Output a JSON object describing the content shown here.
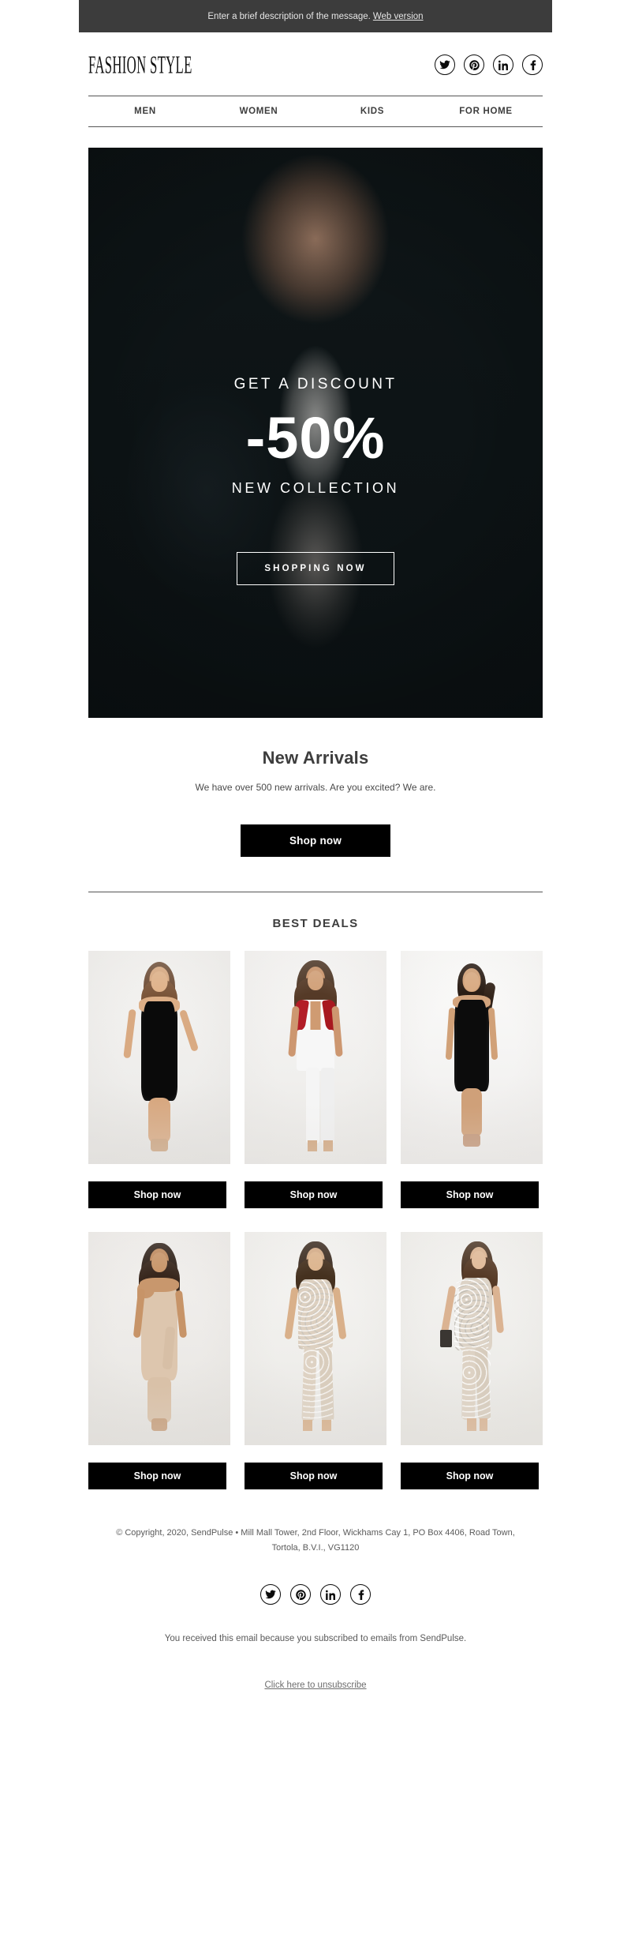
{
  "preheader": {
    "text": "Enter a brief description of the message.",
    "link_label": "Web version",
    "bg_color": "#3c3c3c"
  },
  "header": {
    "logo": "FASHION STYLE",
    "social": [
      {
        "name": "twitter",
        "label": "Twitter"
      },
      {
        "name": "pinterest",
        "label": "Pinterest"
      },
      {
        "name": "linkedin",
        "label": "LinkedIn"
      },
      {
        "name": "facebook",
        "label": "Facebook"
      }
    ]
  },
  "nav": {
    "items": [
      {
        "label": "MEN"
      },
      {
        "label": "WOMEN"
      },
      {
        "label": "KIDS"
      },
      {
        "label": "FOR HOME"
      }
    ]
  },
  "hero": {
    "kicker": "GET A DISCOUNT",
    "discount": "-50%",
    "subtitle": "NEW COLLECTION",
    "cta_label": "SHOPPING NOW",
    "bg_color": "#0d1618"
  },
  "arrivals": {
    "title": "New Arrivals",
    "text": "We have over 500 new arrivals. Are you excited? We are.",
    "cta_label": "Shop now"
  },
  "deals": {
    "title": "BEST DEALS",
    "rows": [
      {
        "products": [
          {
            "alt": "black-midi-dress",
            "cta_label": "Shop now"
          },
          {
            "alt": "white-floral-jumpsuit",
            "cta_label": "Shop now"
          },
          {
            "alt": "black-tank-dress",
            "cta_label": "Shop now"
          }
        ]
      },
      {
        "products": [
          {
            "alt": "nude-one-shoulder-dress",
            "cta_label": "Shop now"
          },
          {
            "alt": "nude-sequin-jumpsuit",
            "cta_label": "Shop now"
          },
          {
            "alt": "embellished-jumpsuit",
            "cta_label": "Shop now"
          }
        ]
      }
    ]
  },
  "footer": {
    "copyright_line1": "© Copyright, 2020, SendPulse • Mill Mall Tower, 2nd Floor, Wickhams Cay 1, PO",
    "copyright_line2": "Box 4406, Road Town, Tortola, B.V.I., VG1120",
    "social": [
      {
        "name": "twitter",
        "label": "Twitter"
      },
      {
        "name": "pinterest",
        "label": "Pinterest"
      },
      {
        "name": "linkedin",
        "label": "LinkedIn"
      },
      {
        "name": "facebook",
        "label": "Facebook"
      }
    ],
    "note": "You received this email because you subscribed to emails from SendPulse.",
    "unsubscribe_label": "Click here to unsubscribe"
  }
}
